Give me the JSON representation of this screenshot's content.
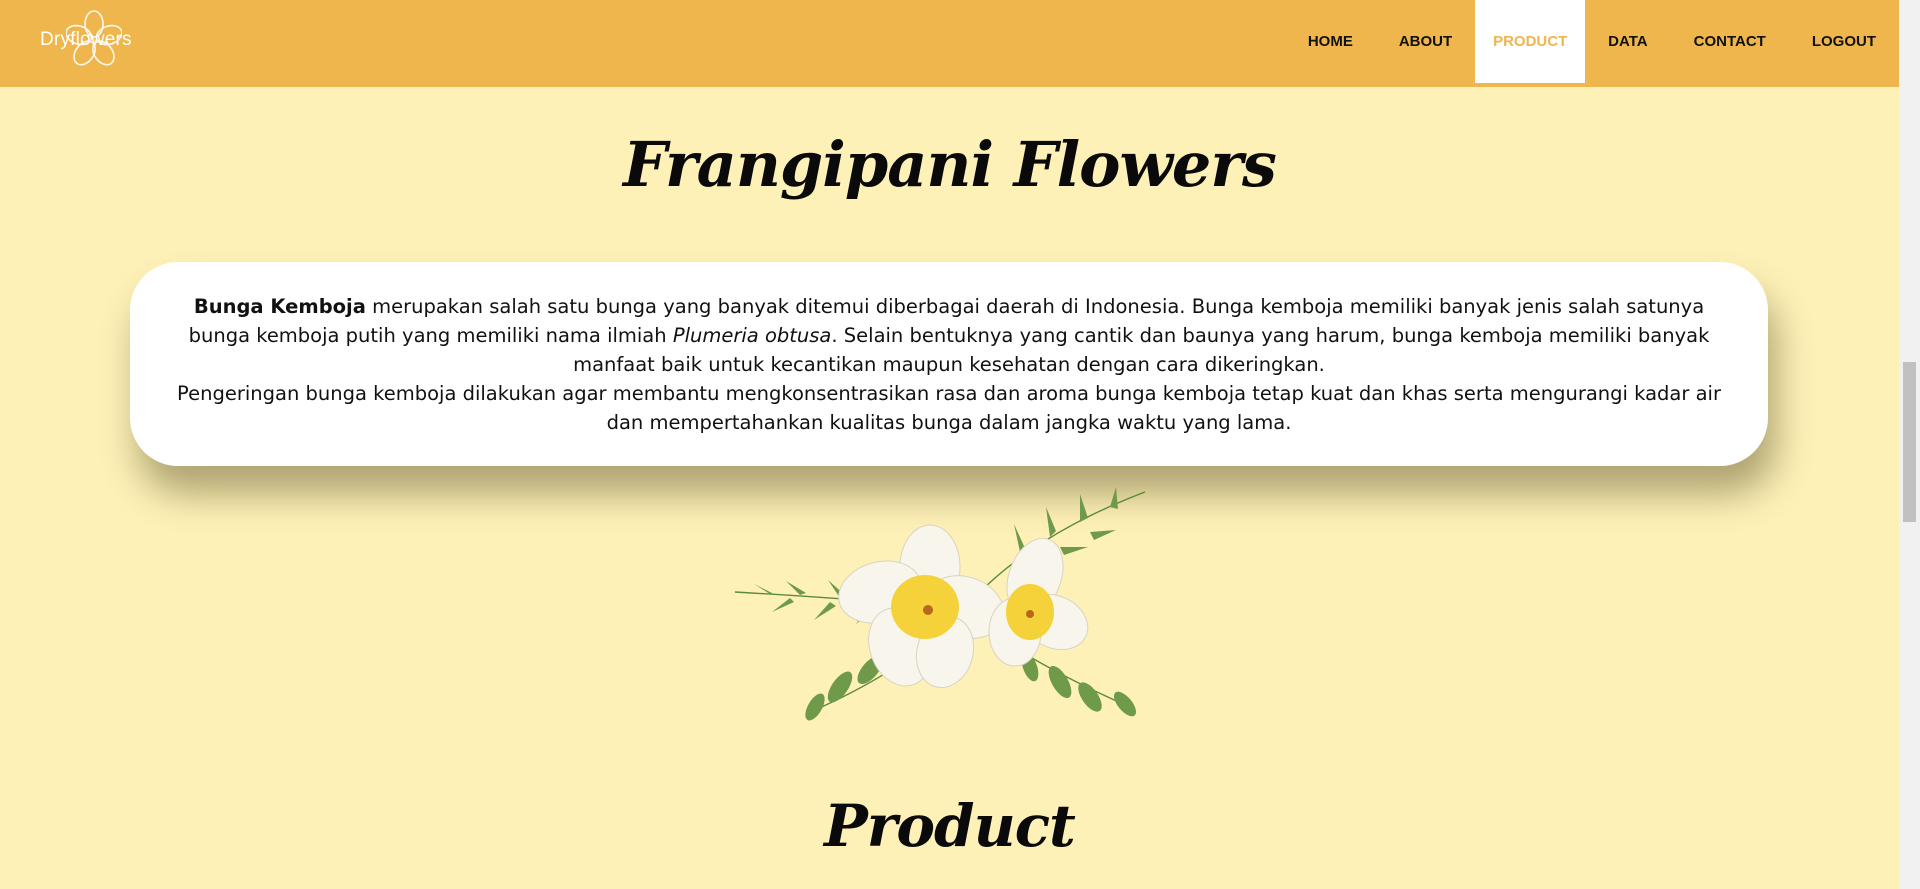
{
  "brand": {
    "name": "Dryflowers"
  },
  "nav": [
    {
      "label": "HOME"
    },
    {
      "label": "ABOUT"
    },
    {
      "label": "PRODUCT"
    },
    {
      "label": "DATA"
    },
    {
      "label": "CONTACT"
    },
    {
      "label": "LOGOUT"
    }
  ],
  "page": {
    "title": "Frangipani Flowers",
    "section_title": "Product"
  },
  "description": {
    "bold_term": "Bunga Kemboja",
    "text_1": " merupakan salah satu bunga yang banyak ditemui diberbagai daerah di Indonesia. Bunga kemboja memiliki banyak jenis salah satunya bunga kemboja putih yang memiliki nama ilmiah ",
    "scientific_name": "Plumeria obtusa",
    "text_2": ". Selain bentuknya yang cantik dan baunya yang harum, bunga kemboja memiliki banyak manfaat baik untuk kecantikan maupun kesehatan dengan cara dikeringkan.",
    "paragraph_2": "Pengeringan bunga kemboja dilakukan agar membantu mengkonsentrasikan rasa dan aroma bunga kemboja tetap kuat dan khas serta mengurangi kadar air dan mempertahankan kualitas bunga dalam jangka waktu yang lama."
  },
  "colors": {
    "navbar": "#eeb64d",
    "background": "#fef1b7",
    "active_nav_text": "#eeb64d"
  },
  "icons": {
    "logo": "frangipani-logo-icon"
  }
}
